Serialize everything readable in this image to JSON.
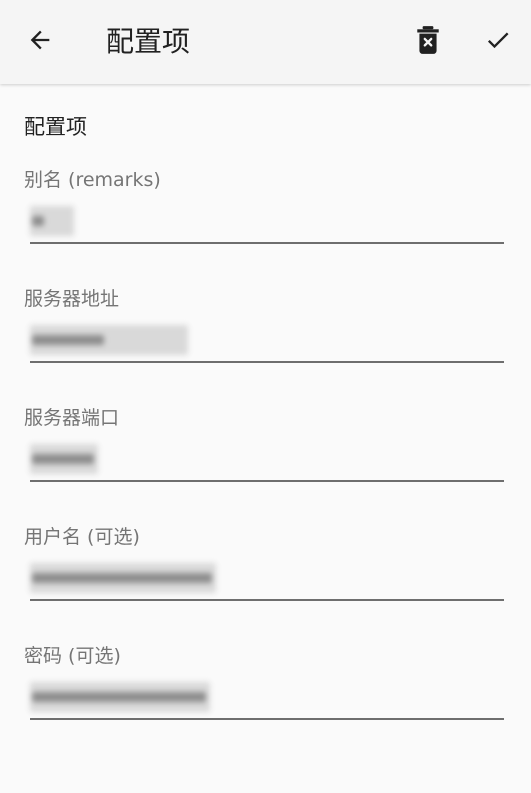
{
  "appbar": {
    "title": "配置项",
    "icons": {
      "back": "arrow-back-icon",
      "delete": "delete-icon",
      "confirm": "check-icon"
    }
  },
  "section": {
    "title": "配置项"
  },
  "fields": [
    {
      "label": "别名 (remarks)",
      "value": "",
      "placeholder": ""
    },
    {
      "label": "服务器地址",
      "value": "",
      "placeholder": ""
    },
    {
      "label": "服务器端口",
      "value": "",
      "placeholder": ""
    },
    {
      "label": "用户名 (可选)",
      "value": "",
      "placeholder": ""
    },
    {
      "label": "密码 (可选)",
      "value": "",
      "placeholder": ""
    }
  ],
  "colors": {
    "appbar_bg": "#f5f5f5",
    "page_bg": "#fafafa",
    "title_text": "#212121",
    "label_text": "#757575",
    "underline": "#6e6e6e"
  }
}
